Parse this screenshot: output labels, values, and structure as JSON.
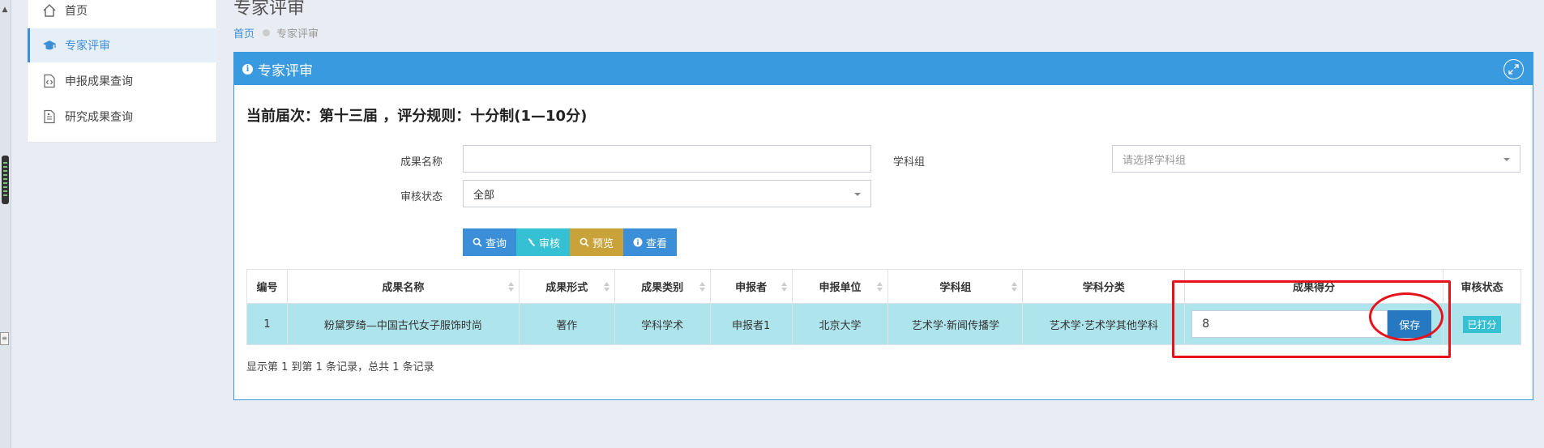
{
  "sidebar": {
    "items": [
      {
        "label": "首页",
        "icon": "home-icon"
      },
      {
        "label": "专家评审",
        "icon": "graduation-cap-icon",
        "active": true
      },
      {
        "label": "申报成果查询",
        "icon": "code-file-icon"
      },
      {
        "label": "研究成果查询",
        "icon": "document-icon"
      }
    ]
  },
  "header": {
    "title": "专家评审",
    "breadcrumb_home": "首页",
    "breadcrumb_current": "专家评审"
  },
  "panel": {
    "title": "专家评审",
    "session_info": "当前届次：第十三届 ，评分规则：十分制(1—10分)"
  },
  "filters": {
    "name_label": "成果名称",
    "name_value": "",
    "group_label": "学科组",
    "group_placeholder": "请选择学科组",
    "status_label": "审核状态",
    "status_value": "全部"
  },
  "buttons": {
    "query": "查询",
    "audit": "审核",
    "preview": "预览",
    "view": "查看"
  },
  "table": {
    "columns": [
      "编号",
      "成果名称",
      "成果形式",
      "成果类别",
      "申报者",
      "申报单位",
      "学科组",
      "学科分类",
      "成果得分",
      "审核状态"
    ],
    "rows": [
      {
        "id": "1",
        "name": "粉黛罗绮—中国古代女子服饰时尚",
        "form": "著作",
        "category": "学科学术",
        "applicant": "申报者1",
        "unit": "北京大学",
        "group": "艺术学·新闻传播学",
        "classification": "艺术学·艺术学其他学科",
        "score": "8",
        "save_label": "保存",
        "status": "已打分"
      }
    ],
    "summary": "显示第 1 到第 1 条记录，总共 1 条记录"
  },
  "colors": {
    "accent": "#3a9ae0",
    "row_highlight": "#aee5ec",
    "annotation": "#e8111a",
    "preview_button": "#c9a23a",
    "audit_button": "#36c0d3"
  }
}
